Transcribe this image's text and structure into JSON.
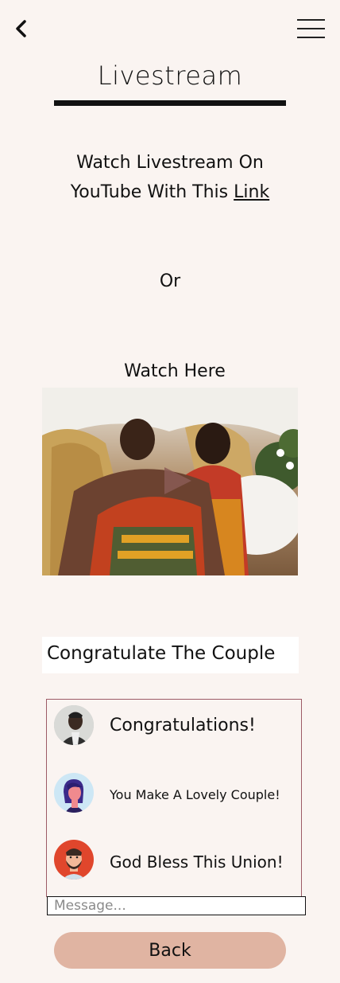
{
  "header": {
    "back_icon": "chevron-left-icon",
    "menu_icon": "hamburger-menu-icon",
    "title": "Livestream"
  },
  "youtube": {
    "line1": "Watch Livestream On",
    "line2_prefix": "YouTube With This ",
    "link_label": "Link"
  },
  "or_text": "Or",
  "watch_here": "Watch Here",
  "video": {
    "play_icon": "play-icon"
  },
  "congratulate": {
    "title": "Congratulate The Couple",
    "messages": [
      {
        "avatar": "avatar-bearded-man-icon",
        "text": "Congratulations!"
      },
      {
        "avatar": "avatar-woman-purple-hair-icon",
        "text": "You Make A Lovely Couple!"
      },
      {
        "avatar": "avatar-man-beard-icon",
        "text": "God Bless This Union!"
      }
    ],
    "input_placeholder": "Message..."
  },
  "back_button_label": "Back",
  "colors": {
    "background": "#faf4f1",
    "button": "#e0b4a2",
    "chat_border": "#9c5a66"
  }
}
